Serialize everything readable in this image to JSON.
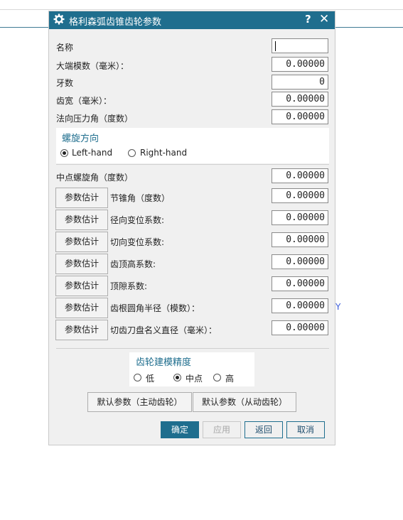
{
  "background": {
    "stray_char": "Y"
  },
  "dialog": {
    "title": "格利森弧齿锥齿轮参数",
    "help": "?",
    "close": "✕"
  },
  "fields": {
    "name_label": "名称",
    "name_value": "",
    "module_label": "大端模数（毫米）：",
    "module_value": "0.00000",
    "teeth_label": "牙数",
    "teeth_value": "0",
    "face_width_label": "齿宽（毫米）：",
    "face_width_value": "0.00000",
    "pressure_angle_label": "法向压力角（度数）",
    "pressure_angle_value": "0.00000"
  },
  "spiral": {
    "title": "螺旋方向",
    "left_hand": "Left-hand",
    "right_hand": "Right-hand",
    "selected": "Left-hand"
  },
  "mid_spiral": {
    "label": "中点螺旋角（度数）",
    "value": "0.00000"
  },
  "estimate_rows": [
    {
      "button": "参数估计",
      "label": "节锥角（度数）",
      "value": "0.00000"
    },
    {
      "button": "参数估计",
      "label": "径向变位系数:",
      "value": "0.00000"
    },
    {
      "button": "参数估计",
      "label": "切向变位系数:",
      "value": "0.00000"
    },
    {
      "button": "参数估计",
      "label": "齿顶高系数:",
      "value": "0.00000"
    },
    {
      "button": "参数估计",
      "label": "顶隙系数:",
      "value": "0.00000"
    },
    {
      "button": "参数估计",
      "label": "齿根圆角半径（模数）：",
      "value": "0.00000"
    },
    {
      "button": "参数估计",
      "label": "切齿刀盘名义直径（毫米）：",
      "value": "0.00000"
    }
  ],
  "precision": {
    "title": "齿轮建模精度",
    "low": "低",
    "mid": "中点",
    "high": "高",
    "selected": "中点"
  },
  "defaults": {
    "driver": "默认参数（主动齿轮）",
    "driven": "默认参数（从动齿轮）"
  },
  "actions": {
    "ok": "确定",
    "apply": "应用",
    "back": "返回",
    "cancel": "取消"
  }
}
